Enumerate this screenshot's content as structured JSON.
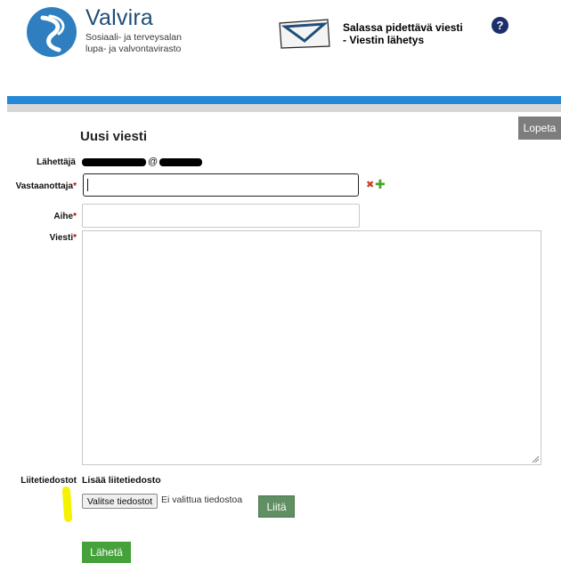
{
  "header": {
    "brand_name": "Valvira",
    "brand_sub_line1": "Sosiaali- ja terveysalan",
    "brand_sub_line2": "lupa- ja valvontavirasto",
    "secure_title_line1": "Salassa pidettävä viesti",
    "secure_title_line2": "- Viestin lähetys",
    "help_symbol": "?"
  },
  "toolbar": {
    "logout_label": "Lopeta"
  },
  "form": {
    "title": "Uusi viesti",
    "sender_label": "Lähettäjä",
    "sender_at": "@",
    "recipient_label": "Vastaanottaja",
    "recipient_value": "",
    "subject_label": "Aihe",
    "subject_value": "",
    "message_label": "Viesti",
    "message_value": "",
    "required_mark": "*",
    "attachments_label": "Liitetiedostot",
    "add_attachment_text": "Lisää liitetiedosto",
    "choose_files_label": "Valitse tiedostot",
    "no_file_text": "Ei valittua tiedostoa",
    "attach_button_label": "Liitä",
    "send_button_label": "Lähetä"
  },
  "icons": {
    "remove_recipient": "close-icon",
    "add_recipient": "plus-icon",
    "help": "help-icon"
  },
  "colors": {
    "brand_blue": "#1f4e79",
    "accent_bar": "#2389d7",
    "send_green": "#45a23a",
    "attach_green": "#5f8f62",
    "logout_gray": "#7d7d7d",
    "highlight_yellow": "#f5f200"
  }
}
